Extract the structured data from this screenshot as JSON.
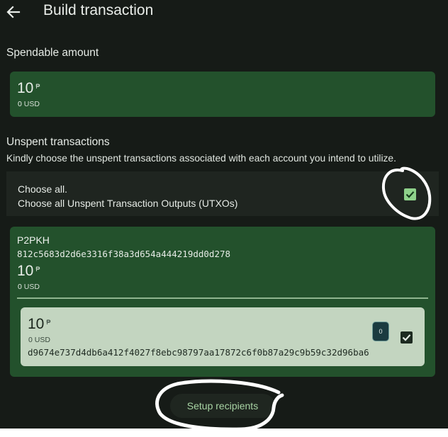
{
  "header": {
    "title": "Build transaction",
    "back_icon": "arrow-left-icon"
  },
  "spendable": {
    "label": "Spendable amount",
    "amount": "10",
    "coin_symbol": "₱",
    "fiat_value": "0",
    "fiat_currency": "USD"
  },
  "unspent": {
    "label": "Unspent transactions",
    "hint": "Kindly choose the unspent transactions associated with each account you intend to utilize.",
    "choose_all_title": "Choose all.",
    "choose_all_subtitle": "Choose all Unspent Transaction Outputs (UTXOs)",
    "choose_all_checked": true
  },
  "account": {
    "type": "P2PKH",
    "address": "812c5683d2d6e3316f38a3d654a444219dd0d278",
    "amount": "10",
    "coin_symbol": "₱",
    "fiat_value": "0",
    "fiat_currency": "USD",
    "utxos": [
      {
        "amount": "10",
        "coin_symbol": "₱",
        "fiat_value": "0",
        "fiat_currency": "USD",
        "txid": "d9674e737d4db6a412f4027f8ebc98797aa17872c6f0b87a29c9b59c32d96ba6",
        "index_badge": "0",
        "checked": true
      }
    ]
  },
  "actions": {
    "setup_recipients": "Setup recipients"
  },
  "colors": {
    "background": "#161b17",
    "card": "#23512c",
    "utxo_card": "#c3d5c0",
    "checkbox_light": "#8ed18a",
    "button_text": "#a8d4a4"
  }
}
